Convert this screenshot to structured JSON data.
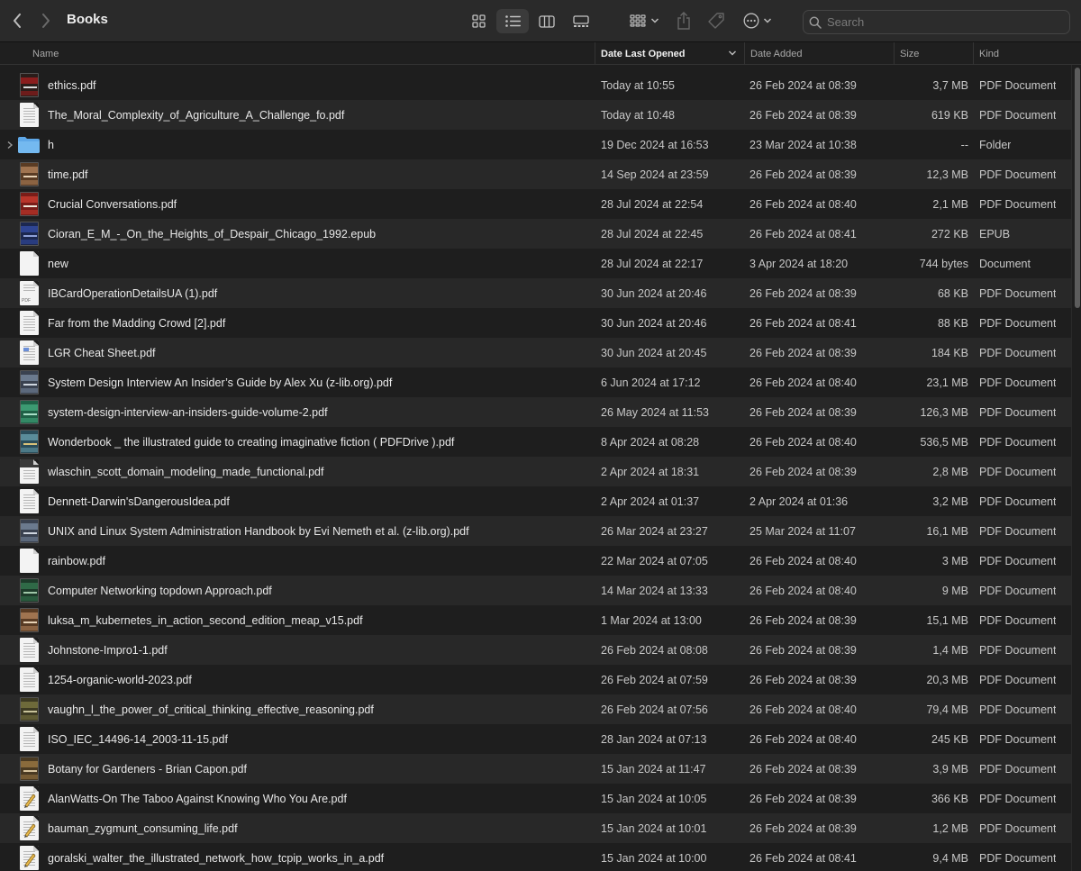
{
  "window": {
    "title": "Books"
  },
  "toolbar": {
    "search_placeholder": "Search",
    "view_modes": [
      "icon-view",
      "list-view",
      "column-view",
      "gallery-view"
    ],
    "active_view": "list-view"
  },
  "columns": {
    "name": "Name",
    "date_last_opened": "Date Last Opened",
    "date_added": "Date Added",
    "size": "Size",
    "kind": "Kind"
  },
  "sort": {
    "column": "date_last_opened",
    "direction": "descending"
  },
  "scroll": {
    "visible_fraction": 0.3,
    "position": 0
  },
  "colors": {
    "accent_folder": "#5fa8e8",
    "background": "#1e1e1e",
    "row_alt": "#282828"
  },
  "files": [
    {
      "name": "ethics.pdf",
      "opened": "Today at 10:55",
      "added": "26 Feb 2024 at 08:39",
      "size": "3,7 MB",
      "kind": "PDF Document",
      "icon": "cover-dark-red"
    },
    {
      "name": "The_Moral_Complexity_of_Agriculture_A_Challenge_fo.pdf",
      "opened": "Today at 10:48",
      "added": "26 Feb 2024 at 08:39",
      "size": "619 KB",
      "kind": "PDF Document",
      "icon": "page"
    },
    {
      "name": "h",
      "opened": "19 Dec 2024 at 16:53",
      "added": "23 Mar 2024 at 10:38",
      "size": "--",
      "kind": "Folder",
      "icon": "folder"
    },
    {
      "name": "time.pdf",
      "opened": "14 Sep 2024 at 23:59",
      "added": "26 Feb 2024 at 08:39",
      "size": "12,3 MB",
      "kind": "PDF Document",
      "icon": "cover-brown"
    },
    {
      "name": "Crucial Conversations.pdf",
      "opened": "28 Jul 2024 at 22:54",
      "added": "26 Feb 2024 at 08:40",
      "size": "2,1 MB",
      "kind": "PDF Document",
      "icon": "cover-red"
    },
    {
      "name": "Cioran_E_M_-_On_the_Heights_of_Despair_Chicago_1992.epub",
      "opened": "28 Jul 2024 at 22:45",
      "added": "26 Feb 2024 at 08:41",
      "size": "272 KB",
      "kind": "EPUB",
      "icon": "cover-navy"
    },
    {
      "name": "new",
      "opened": "28 Jul 2024 at 22:17",
      "added": "3 Apr 2024 at 18:20",
      "size": "744 bytes",
      "kind": "Document",
      "icon": "blank"
    },
    {
      "name": "IBCardOperationDetailsUA (1).pdf",
      "opened": "30 Jun 2024 at 20:46",
      "added": "26 Feb 2024 at 08:39",
      "size": "68 KB",
      "kind": "PDF Document",
      "icon": "pdf-page"
    },
    {
      "name": "Far from the Madding Crowd [2].pdf",
      "opened": "30 Jun 2024 at 20:46",
      "added": "26 Feb 2024 at 08:41",
      "size": "88 KB",
      "kind": "PDF Document",
      "icon": "page"
    },
    {
      "name": "LGR Cheat Sheet.pdf",
      "opened": "30 Jun 2024 at 20:45",
      "added": "26 Feb 2024 at 08:39",
      "size": "184 KB",
      "kind": "PDF Document",
      "icon": "page-color"
    },
    {
      "name": "System Design Interview An Insider’s Guide by Alex Xu (z-lib.org).pdf",
      "opened": "6 Jun 2024 at 17:12",
      "added": "26 Feb 2024 at 08:40",
      "size": "23,1 MB",
      "kind": "PDF Document",
      "icon": "cover-slate"
    },
    {
      "name": "system-design-interview-an-insiders-guide-volume-2.pdf",
      "opened": "26 May 2024 at 11:53",
      "added": "26 Feb 2024 at 08:39",
      "size": "126,3 MB",
      "kind": "PDF Document",
      "icon": "cover-green"
    },
    {
      "name": "Wonderbook _ the illustrated guide to creating imaginative fiction ( PDFDrive ).pdf",
      "opened": "8 Apr 2024 at 08:28",
      "added": "26 Feb 2024 at 08:40",
      "size": "536,5 MB",
      "kind": "PDF Document",
      "icon": "cover-teal"
    },
    {
      "name": "wlaschin_scott_domain_modeling_made_functional.pdf",
      "opened": "2 Apr 2024 at 18:31",
      "added": "26 Feb 2024 at 08:39",
      "size": "2,8 MB",
      "kind": "PDF Document",
      "icon": "page-dark"
    },
    {
      "name": "Dennett-Darwin'sDangerousIdea.pdf",
      "opened": "2 Apr 2024 at 01:37",
      "added": "2 Apr 2024 at 01:36",
      "size": "3,2 MB",
      "kind": "PDF Document",
      "icon": "page"
    },
    {
      "name": "UNIX and Linux System Administration Handbook by Evi Nemeth et al. (z-lib.org).pdf",
      "opened": "26 Mar 2024 at 23:27",
      "added": "25 Mar 2024 at 11:07",
      "size": "16,1 MB",
      "kind": "PDF Document",
      "icon": "cover-slate"
    },
    {
      "name": "rainbow.pdf",
      "opened": "22 Mar 2024 at 07:05",
      "added": "26 Feb 2024 at 08:40",
      "size": "3 MB",
      "kind": "PDF Document",
      "icon": "blank"
    },
    {
      "name": "Computer Networking topdown Approach.pdf",
      "opened": "14 Mar 2024 at 13:33",
      "added": "26 Feb 2024 at 08:40",
      "size": "9 MB",
      "kind": "PDF Document",
      "icon": "cover-green-dark"
    },
    {
      "name": "luksa_m_kubernetes_in_action_second_edition_meap_v15.pdf",
      "opened": "1 Mar 2024 at 13:00",
      "added": "26 Feb 2024 at 08:39",
      "size": "15,1 MB",
      "kind": "PDF Document",
      "icon": "cover-brown"
    },
    {
      "name": "Johnstone-Impro1-1.pdf",
      "opened": "26 Feb 2024 at 08:08",
      "added": "26 Feb 2024 at 08:39",
      "size": "1,4 MB",
      "kind": "PDF Document",
      "icon": "page"
    },
    {
      "name": "1254-organic-world-2023.pdf",
      "opened": "26 Feb 2024 at 07:59",
      "added": "26 Feb 2024 at 08:39",
      "size": "20,3 MB",
      "kind": "PDF Document",
      "icon": "page"
    },
    {
      "name": "vaughn_l_the_power_of_critical_thinking_effective_reasoning.pdf",
      "opened": "26 Feb 2024 at 07:56",
      "added": "26 Feb 2024 at 08:40",
      "size": "79,4 MB",
      "kind": "PDF Document",
      "icon": "cover-olive"
    },
    {
      "name": "ISO_IEC_14496-14_2003-11-15.pdf",
      "opened": "28 Jan 2024 at 07:13",
      "added": "26 Feb 2024 at 08:40",
      "size": "245 KB",
      "kind": "PDF Document",
      "icon": "page"
    },
    {
      "name": "Botany for Gardeners - Brian Capon.pdf",
      "opened": "15 Jan 2024 at 11:47",
      "added": "26 Feb 2024 at 08:39",
      "size": "3,9 MB",
      "kind": "PDF Document",
      "icon": "cover-earth"
    },
    {
      "name": "AlanWatts-On The Taboo Against Knowing Who You Are.pdf",
      "opened": "15 Jan 2024 at 10:05",
      "added": "26 Feb 2024 at 08:39",
      "size": "366 KB",
      "kind": "PDF Document",
      "icon": "preview-pen"
    },
    {
      "name": "bauman_zygmunt_consuming_life.pdf",
      "opened": "15 Jan 2024 at 10:01",
      "added": "26 Feb 2024 at 08:39",
      "size": "1,2 MB",
      "kind": "PDF Document",
      "icon": "preview-pen"
    },
    {
      "name": "goralski_walter_the_illustrated_network_how_tcpip_works_in_a.pdf",
      "opened": "15 Jan 2024 at 10:00",
      "added": "26 Feb 2024 at 08:41",
      "size": "9,4 MB",
      "kind": "PDF Document",
      "icon": "preview-pen"
    }
  ]
}
